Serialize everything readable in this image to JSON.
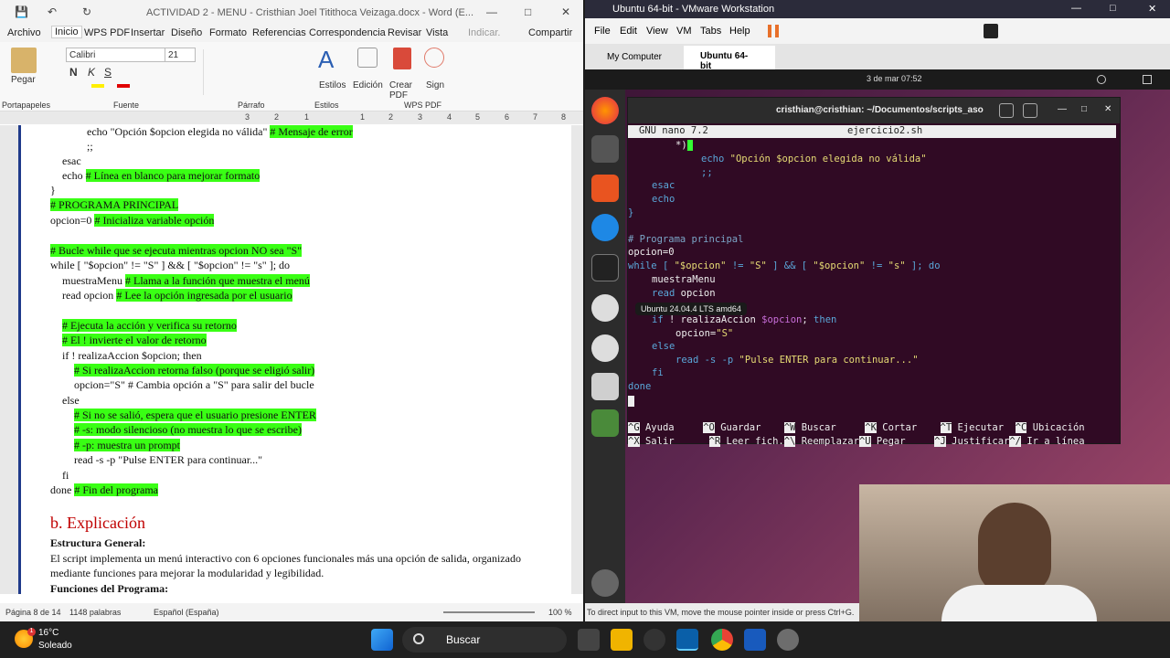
{
  "word": {
    "title": "ACTIVIDAD 2 - MENU - Cristhian Joel Titithoca Veizaga.docx - Word (E...",
    "menu": [
      "Archivo",
      "Inicio",
      "WPS PDF",
      "Insertar",
      "Diseño",
      "Formato",
      "Referencias",
      "Correspondencia",
      "Revisar",
      "Vista",
      "Indicar.",
      "Compartir"
    ],
    "ribbon": {
      "paste": "Pegar",
      "font_name": "Calibri",
      "font_size": "21",
      "styles": "Estilos",
      "edit": "Edición",
      "create_pdf": "Crear PDF",
      "sign": "Sign",
      "groups": [
        "Portapapeles",
        "Fuente",
        "Párrafo",
        "Estilos",
        "WPS PDF"
      ]
    },
    "ruler_marks": [
      "3",
      "2",
      "1",
      "1",
      "2",
      "3",
      "4",
      "5",
      "6",
      "7",
      "8"
    ],
    "lines": [
      {
        "text": "echo \"Opción $opcion elegida no válida\"",
        "hl": "# Mensaje de error"
      },
      {
        "text": ";;",
        "hl": ""
      },
      {
        "text": "esac",
        "hl": ""
      },
      {
        "text": "echo",
        "hl": "# Línea en blanco para mejorar formato"
      },
      {
        "text": "}",
        "hl": ""
      },
      {
        "text": "",
        "hl": "# PROGRAMA PRINCIPAL"
      },
      {
        "text": "opcion=0",
        "hl": "# Inicializa variable opción"
      },
      {
        "text": "",
        "hl": "# Bucle while que se ejecuta mientras opcion NO sea \"S\""
      },
      {
        "text": "while [ \"$opcion\" != \"S\" ] && [ \"$opcion\" != \"s\" ]; do",
        "hl": ""
      },
      {
        "text": "muestraMenu",
        "hl": "# Llama a la función que muestra el menú"
      },
      {
        "text": "read opcion",
        "hl": "# Lee la opción ingresada por el usuario"
      },
      {
        "text": "",
        "hl": "# Ejecuta la acción y verifica su retorno"
      },
      {
        "text": "",
        "hl": "# El ! invierte el valor de retorno"
      },
      {
        "text": "if ! realizaAccion $opcion; then",
        "hl": ""
      },
      {
        "text": "",
        "hl": "# Si realizaAccion retorna falso (porque se eligió salir)"
      },
      {
        "text": "opcion=\"S\"",
        "hl": "# Cambia opción a \"S\" para salir del bucle"
      },
      {
        "text": "else",
        "hl": ""
      },
      {
        "text": "",
        "hl": "# Si no se salió, espera que el usuario presione ENTER"
      },
      {
        "text": "",
        "hl": "# -s: modo silencioso (no muestra lo que se escribe)"
      },
      {
        "text": "",
        "hl": "# -p: muestra un prompt"
      },
      {
        "text": "read -s -p \"Pulse ENTER para continuar...\"",
        "hl": ""
      },
      {
        "text": "fi",
        "hl": ""
      },
      {
        "text": "done",
        "hl": "# Fin del programa"
      }
    ],
    "heading": "b. Explicación",
    "sub1": "Estructura General:",
    "para": "El script implementa un menú interactivo con 6 opciones funcionales más una opción de salida, organizado mediante funciones para mejorar la modularidad y legibilidad.",
    "sub2": "Funciones del Programa:",
    "status": {
      "page": "Página 8 de 14",
      "words": "1148 palabras",
      "lang": "Español (España)",
      "zoom": "100 %"
    }
  },
  "vmware": {
    "title": "Ubuntu 64-bit - VMware Workstation",
    "menu": [
      "File",
      "Edit",
      "View",
      "VM",
      "Tabs",
      "Help"
    ],
    "tabs": [
      "My Computer",
      "Ubuntu 64-bit"
    ],
    "clock": "3 de mar  07:52",
    "terminal_title": "cristhian@cristhian: ~/Documentos/scripts_aso",
    "nano_version": "GNU nano 7.2",
    "nano_file": "ejercicio2.sh",
    "tooltip": "Ubuntu 24.04.4 LTS amd64",
    "shortcuts_row1": [
      [
        "^G",
        "Ayuda"
      ],
      [
        "^O",
        "Guardar"
      ],
      [
        "^W",
        "Buscar"
      ],
      [
        "^K",
        "Cortar"
      ],
      [
        "^T",
        "Ejecutar"
      ],
      [
        "^C",
        "Ubicación"
      ]
    ],
    "shortcuts_row2": [
      [
        "^X",
        "Salir"
      ],
      [
        "^R",
        "Leer fich."
      ],
      [
        "^\\",
        "Reemplazar"
      ],
      [
        "^U",
        "Pegar"
      ],
      [
        "^J",
        "Justificar"
      ],
      [
        "^/",
        "Ir a línea"
      ]
    ],
    "status": "To direct input to this VM, move the mouse pointer inside or press Ctrl+G."
  },
  "taskbar": {
    "weather_temp": "16°C",
    "weather_desc": "Soleado",
    "search": "Buscar",
    "weather_badge": "1"
  }
}
